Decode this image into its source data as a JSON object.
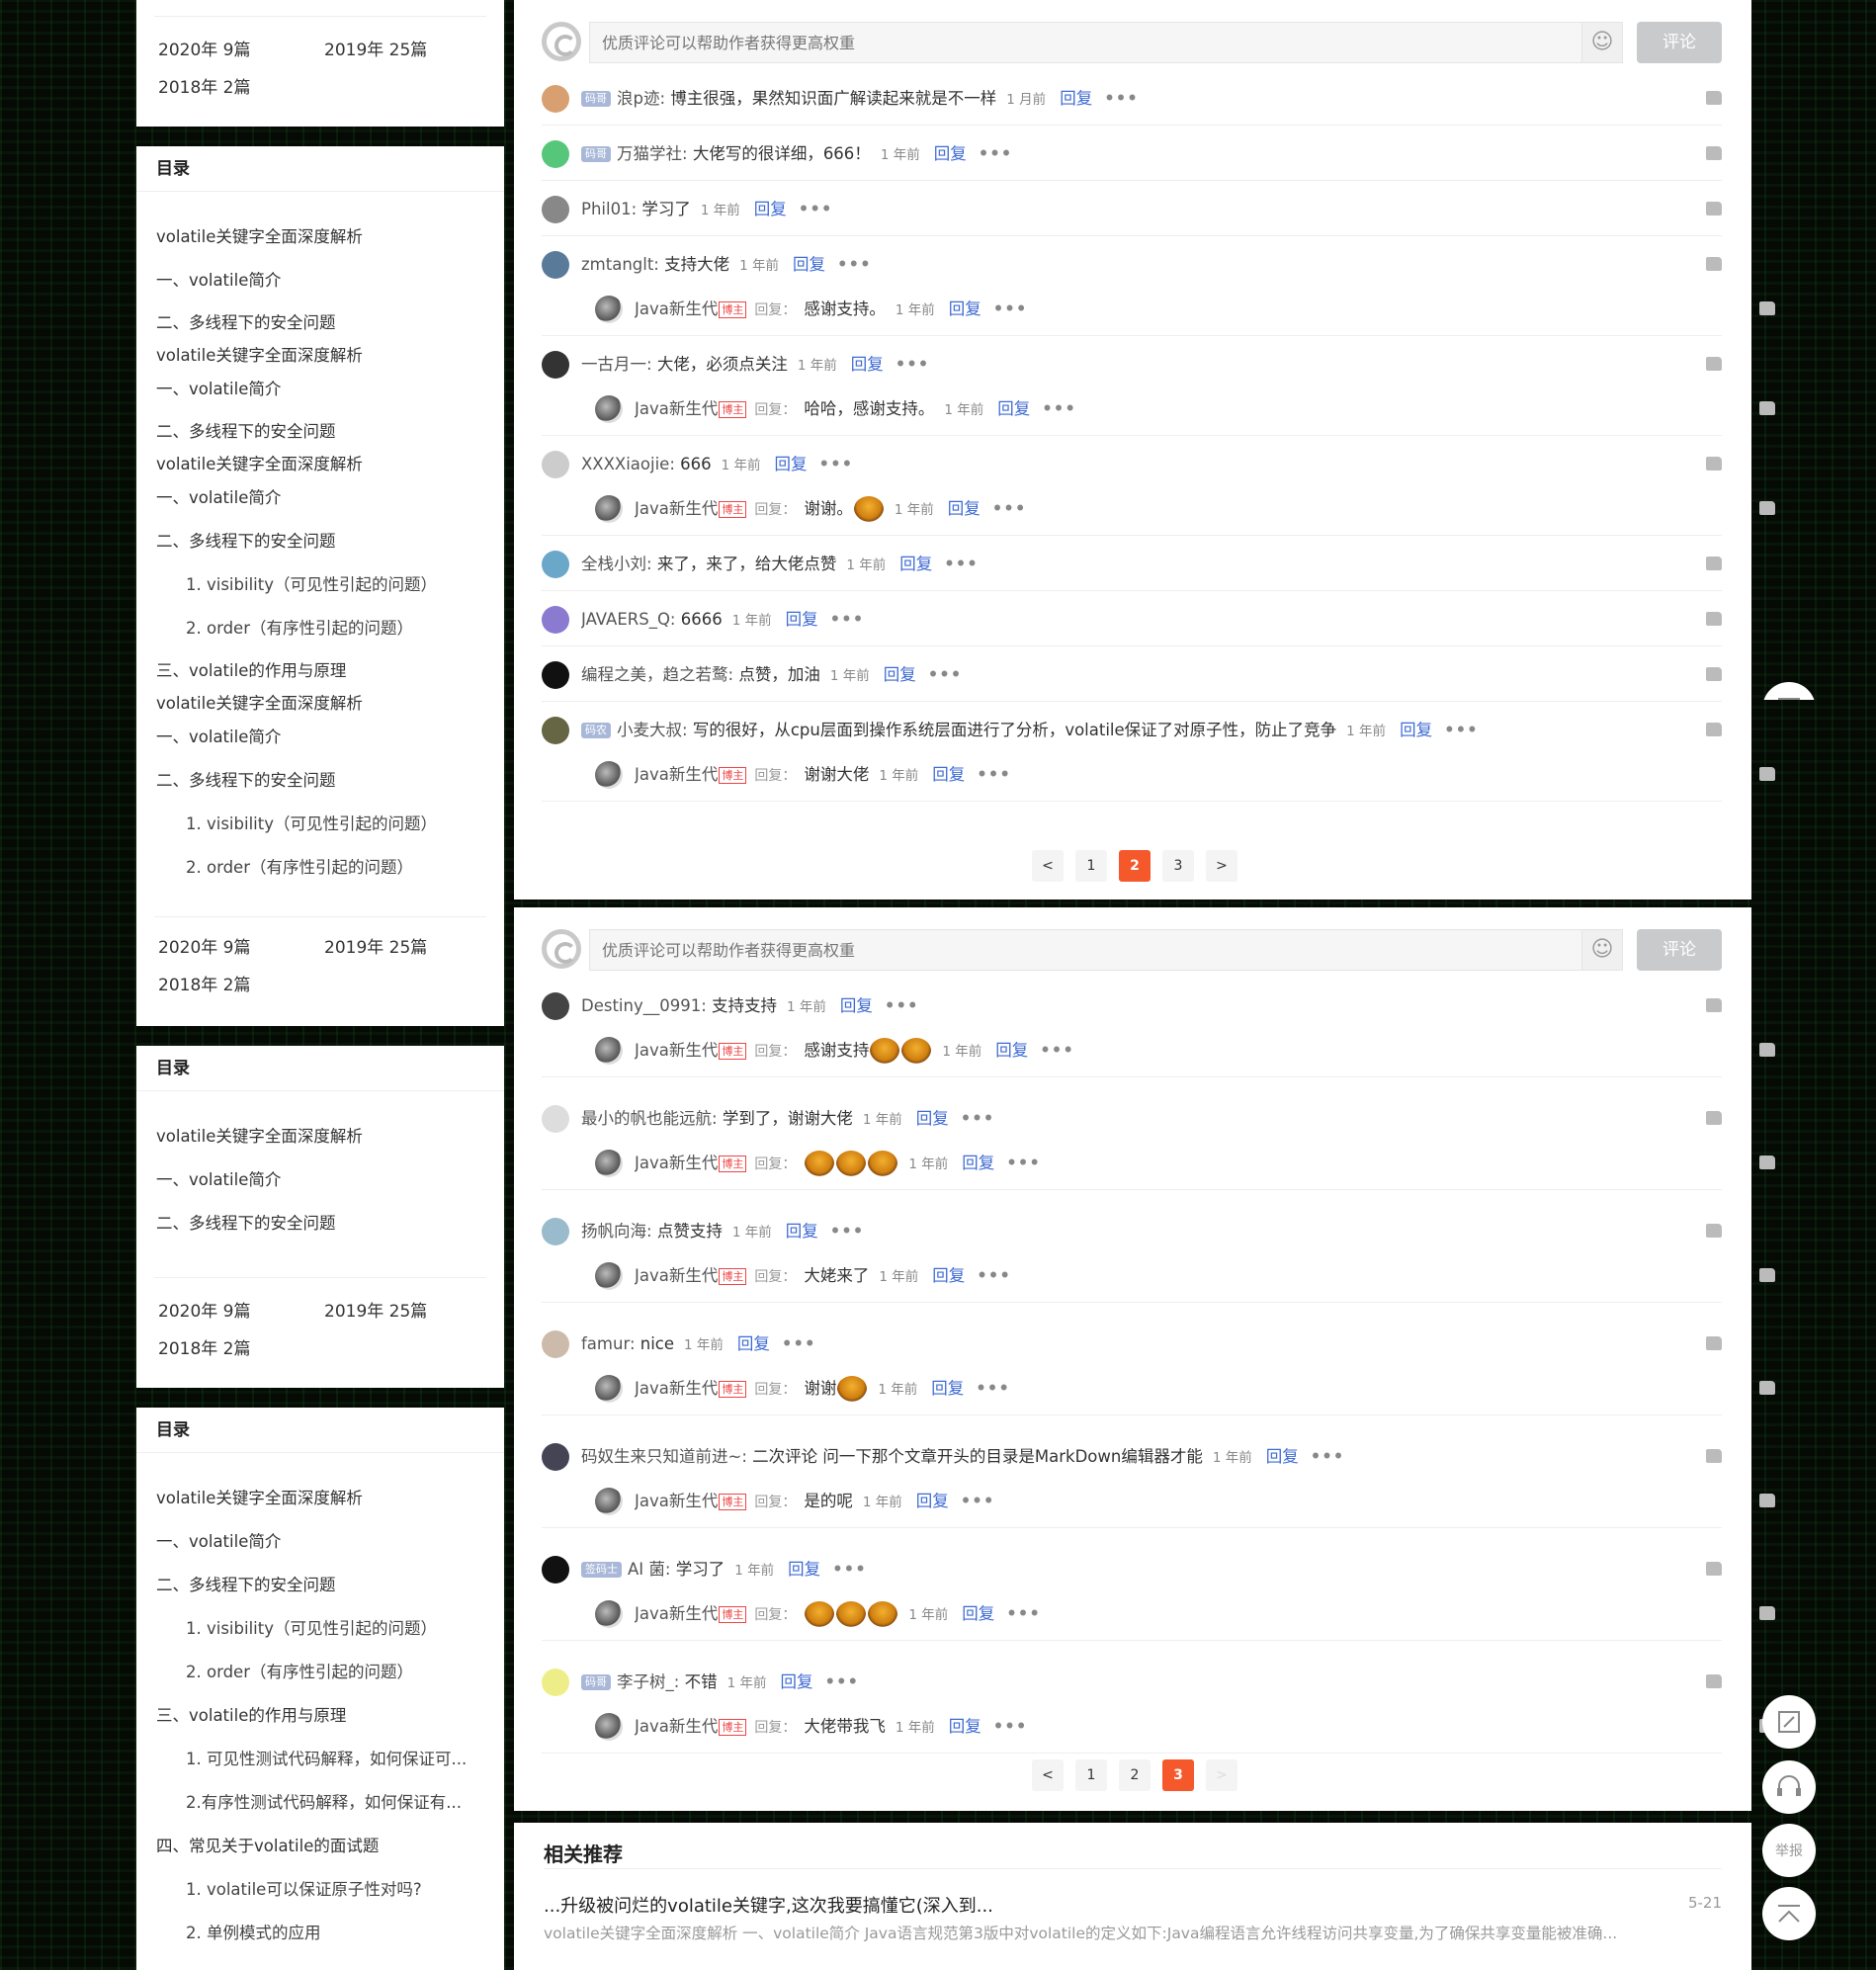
{
  "archive": {
    "y2020": "2020年  9篇",
    "y2019": "2019年  25篇",
    "y2018": "2018年  2篇"
  },
  "toc_header": "目录",
  "toc1": [
    "volatile关键字全面深度解析",
    "一、volatile简介",
    "二、多线程下的安全问题",
    "volatile关键字全面深度解析",
    "一、volatile简介",
    "二、多线程下的安全问题",
    "volatile关键字全面深度解析",
    "一、volatile简介",
    "二、多线程下的安全问题",
    "1. visibility（可见性引起的问题）",
    "2. order（有序性引起的问题）",
    "三、volatile的作用与原理",
    "volatile关键字全面深度解析",
    "一、volatile简介",
    "二、多线程下的安全问题",
    "1. visibility（可见性引起的问题）",
    "2. order（有序性引起的问题）"
  ],
  "toc2": [
    "volatile关键字全面深度解析",
    "一、volatile简介",
    "二、多线程下的安全问题"
  ],
  "toc3": [
    "volatile关键字全面深度解析",
    "一、volatile简介",
    "二、多线程下的安全问题",
    "1. visibility（可见性引起的问题）",
    "2. order（有序性引起的问题）",
    "三、volatile的作用与原理",
    "1. 可见性测试代码解释，如何保证可...",
    "2.有序性测试代码解释，如何保证有...",
    "四、常见关于volatile的面试题",
    "1. volatile可以保证原子性对吗?",
    "2. 单例模式的应用"
  ],
  "comment_input": {
    "placeholder": "优质评论可以帮助作者获得更高权重",
    "submit": "评论",
    "emoji": "☺"
  },
  "ui": {
    "reply": "回复",
    "reply_prefix": "回复：",
    "dots": "•••",
    "blogger": "博主",
    "author": "Java新生代"
  },
  "page1": [
    {
      "badge": "码哥",
      "name": "浪p迹:",
      "text": "博主很强，果然知识面广解读起来就是不一样",
      "time": "1 月前",
      "color": "#d8a070"
    },
    {
      "badge": "码哥",
      "name": "万猫学社:",
      "text": "大佬写的很详细，666！",
      "time": "1 年前",
      "color": "#56c77a"
    },
    {
      "name": "Phil01:",
      "text": "学习了",
      "time": "1 年前",
      "color": "#888"
    },
    {
      "name": "zmtanglt:",
      "text": "支持大佬",
      "time": "1 年前",
      "color": "#5a7a9a",
      "reply": {
        "text": "感谢支持。",
        "time": "1 年前"
      }
    },
    {
      "name": "一古月一:",
      "text": "大佬，必须点关注",
      "time": "1 年前",
      "color": "#333",
      "reply": {
        "text": "哈哈，感谢支持。",
        "time": "1 年前"
      }
    },
    {
      "name": "XXXXiaojie:",
      "text": "666",
      "time": "1 年前",
      "color": "#ccc",
      "reply": {
        "text": "谢谢。",
        "time": "1 年前",
        "emoji": 1
      }
    },
    {
      "name": "全栈小刘:",
      "text": "来了，来了，给大佬点赞",
      "time": "1 年前",
      "color": "#6aa7c9"
    },
    {
      "name": "JAVAERS_Q:",
      "text": "6666",
      "time": "1 年前",
      "color": "#8a7ad0"
    },
    {
      "name": "编程之美，趋之若鹜:",
      "text": "点赞，加油",
      "time": "1 年前",
      "color": "#111"
    },
    {
      "badge": "码农",
      "name": "小麦大叔:",
      "text": "写的很好，从cpu层面到操作系统层面进行了分析，volatile保证了对原子性，防止了竞争",
      "time": "1 年前",
      "color": "#664",
      "reply": {
        "text": "谢谢大佬",
        "time": "1 年前"
      }
    }
  ],
  "page1_pages": {
    "prev": "<",
    "p1": "1",
    "p2": "2",
    "p3": "3",
    "next": ">"
  },
  "page2": [
    {
      "name": "Destiny__0991:",
      "text": "支持支持",
      "time": "1 年前",
      "color": "#444",
      "reply": {
        "text": "感谢支持",
        "time": "1 年前",
        "emoji": 2
      }
    },
    {
      "name": "最小的帆也能远航:",
      "text": "学到了，谢谢大佬",
      "time": "1 年前",
      "color": "#ddd",
      "reply": {
        "text": "",
        "time": "1 年前",
        "emoji": 3
      }
    },
    {
      "name": "扬帆向海:",
      "text": "点赞支持",
      "time": "1 年前",
      "color": "#9bc",
      "reply": {
        "text": "大姥来了",
        "time": "1 年前"
      }
    },
    {
      "name": "famur:",
      "text": "nice",
      "time": "1 年前",
      "color": "#cba",
      "reply": {
        "text": "谢谢",
        "time": "1 年前",
        "emoji": 1
      }
    },
    {
      "name": "码奴生来只知道前进~:",
      "text": "二次评论 问一下那个文章开头的目录是MarkDown编辑器才能",
      "time": "1 年前",
      "color": "#445",
      "reply": {
        "text": "是的呢",
        "time": "1 年前"
      }
    },
    {
      "badge": "签码士",
      "name": "AI 菌:",
      "text": "学习了",
      "time": "1 年前",
      "color": "#111",
      "reply": {
        "text": "",
        "time": "1 年前",
        "emoji": 3
      }
    },
    {
      "badge": "码哥",
      "name": "李子树_:",
      "text": "不错",
      "time": "1 年前",
      "color": "#ee8",
      "reply": {
        "text": "大佬带我飞",
        "time": "1 年前"
      }
    }
  ],
  "related": {
    "title": "相关推荐",
    "item_title": "...升级被问烂的volatile关键字,这次我要搞懂它(深入到...",
    "item_date": "5-21",
    "item_snippet": "volatile关键字全面深度解析 一、volatile简介 Java语言规范第3版中对volatile的定义如下:Java编程语言允许线程访问共享变量,为了确保共享变量能被准确..."
  },
  "float": {
    "report": "举报"
  }
}
